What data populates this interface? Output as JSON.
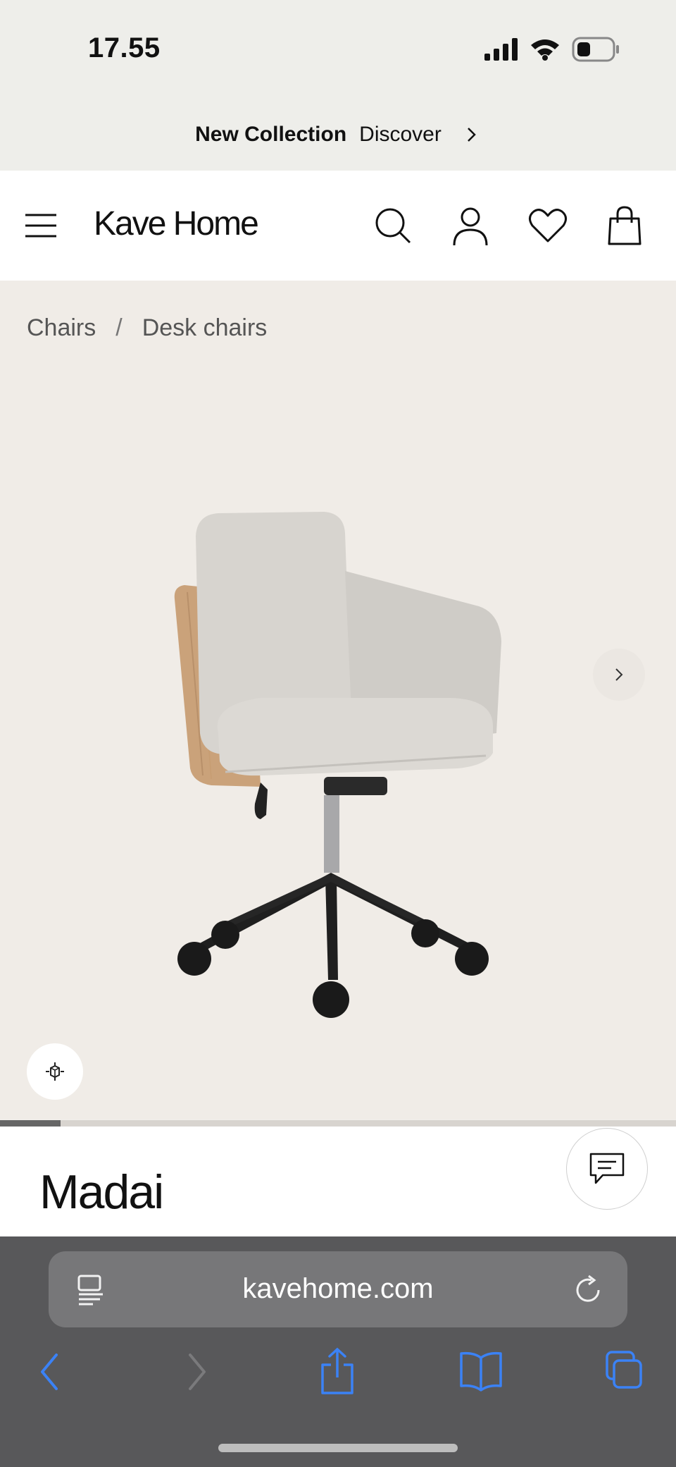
{
  "status_bar": {
    "time": "17.55",
    "icons": [
      "signal-icon",
      "wifi-icon",
      "battery-icon"
    ]
  },
  "promo": {
    "title": "New Collection",
    "link": "Discover",
    "icon": "chevron-right-icon"
  },
  "header": {
    "logo": "Kave Home",
    "icons": [
      "menu-icon",
      "search-icon",
      "account-icon",
      "heart-icon",
      "shopping-bag-icon"
    ]
  },
  "breadcrumb": {
    "items": [
      "Chairs",
      "Desk chairs"
    ],
    "separator": "/"
  },
  "gallery": {
    "image_subject": "desk chair",
    "progress": 0.09,
    "icons": [
      "chevron-right-icon",
      "ar-view-icon"
    ]
  },
  "product": {
    "title": "Madai"
  },
  "chat": {
    "icon": "chat-bubble-icon"
  },
  "browser": {
    "url": "kavehome.com",
    "icons": [
      "tabs-list-icon",
      "reload-icon",
      "back-icon",
      "forward-icon",
      "share-icon",
      "bookmarks-icon",
      "tabs-icon"
    ]
  },
  "colors": {
    "accent": "#3b82f6",
    "product_bg": "#f0ece7",
    "chrome_bg": "#58585a"
  }
}
